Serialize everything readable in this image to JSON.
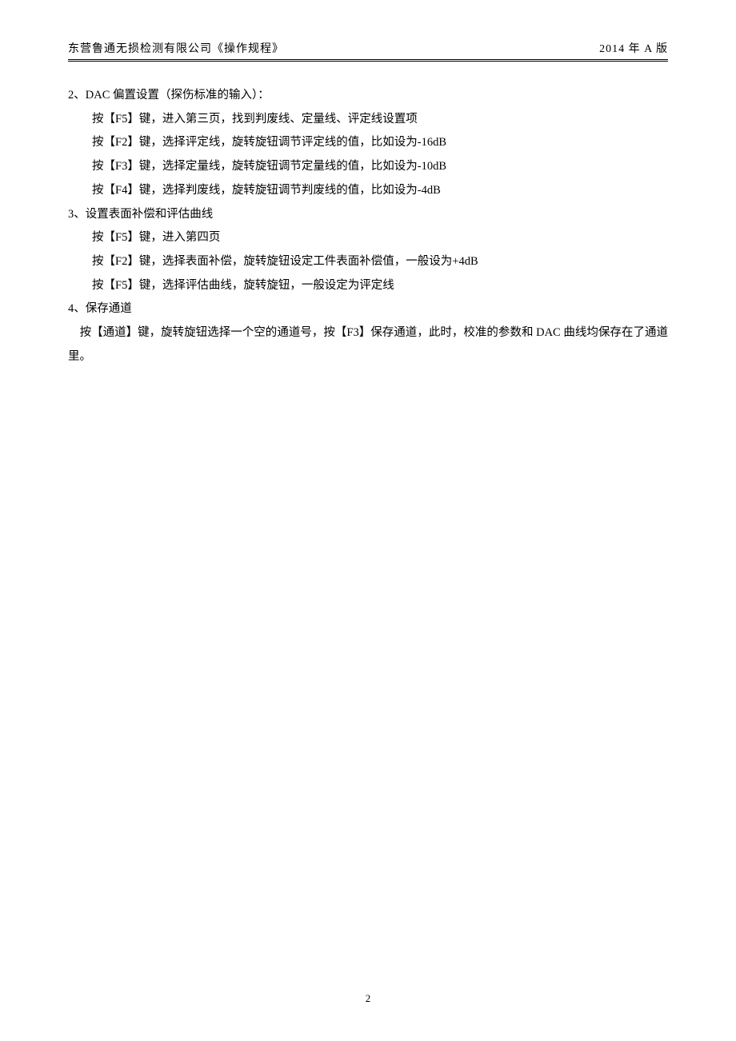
{
  "header": {
    "left": "东营鲁通无损检测有限公司《操作规程》",
    "right": "2014 年 A 版"
  },
  "content": {
    "section2_title": "2、DAC 偏置设置（探伤标准的输入）：",
    "section2_line1": "按【F5】键，进入第三页，找到判废线、定量线、评定线设置项",
    "section2_line2": "按【F2】键，选择评定线，旋转旋钮调节评定线的值，比如设为-16dB",
    "section2_line3": "按【F3】键，选择定量线，旋转旋钮调节定量线的值，比如设为-10dB",
    "section2_line4": "按【F4】键，选择判废线，旋转旋钮调节判废线的值，比如设为-4dB",
    "section3_title": "3、设置表面补偿和评估曲线",
    "section3_line1": "按【F5】键，进入第四页",
    "section3_line2": "按【F2】键，选择表面补偿，旋转旋钮设定工件表面补偿值，一般设为+4dB",
    "section3_line3": "按【F5】键，选择评估曲线，旋转旋钮，一般设定为评定线",
    "section4_title": "4、保存通道",
    "section4_line1": "    按【通道】键，旋转旋钮选择一个空的通道号，按【F3】保存通道，此时，校准的参数和 DAC 曲线均保存在了通道里。"
  },
  "footer": {
    "page_number": "2"
  }
}
